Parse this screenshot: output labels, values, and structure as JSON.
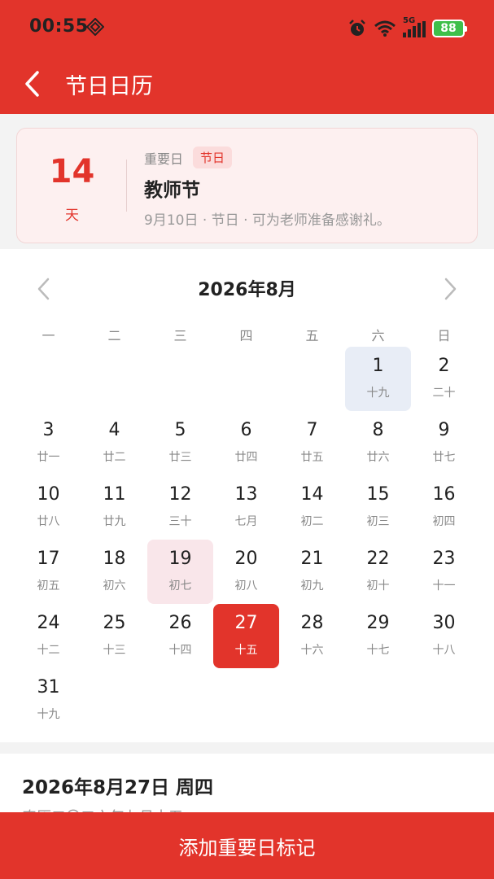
{
  "status_bar": {
    "time": "00:55",
    "network": "5G",
    "battery": "88"
  },
  "nav": {
    "title": "节日日历"
  },
  "event_card": {
    "count": "14",
    "count_unit": "天",
    "category": "重要日",
    "tag": "节日",
    "title": "教师节",
    "description": "9月10日 · 节日 · 可为老师准备感谢礼。"
  },
  "calendar": {
    "month_label": "2026年8月",
    "weekdays": [
      "一",
      "二",
      "三",
      "四",
      "五",
      "六",
      "日"
    ],
    "days": [
      {
        "num": "1",
        "lunar": "十九"
      },
      {
        "num": "2",
        "lunar": "二十"
      },
      {
        "num": "3",
        "lunar": "廿一"
      },
      {
        "num": "4",
        "lunar": "廿二"
      },
      {
        "num": "5",
        "lunar": "廿三"
      },
      {
        "num": "6",
        "lunar": "廿四"
      },
      {
        "num": "7",
        "lunar": "廿五"
      },
      {
        "num": "8",
        "lunar": "廿六"
      },
      {
        "num": "9",
        "lunar": "廿七"
      },
      {
        "num": "10",
        "lunar": "廿八"
      },
      {
        "num": "11",
        "lunar": "廿九"
      },
      {
        "num": "12",
        "lunar": "三十"
      },
      {
        "num": "13",
        "lunar": "七月"
      },
      {
        "num": "14",
        "lunar": "初二"
      },
      {
        "num": "15",
        "lunar": "初三"
      },
      {
        "num": "16",
        "lunar": "初四"
      },
      {
        "num": "17",
        "lunar": "初五"
      },
      {
        "num": "18",
        "lunar": "初六"
      },
      {
        "num": "19",
        "lunar": "初七"
      },
      {
        "num": "20",
        "lunar": "初八"
      },
      {
        "num": "21",
        "lunar": "初九"
      },
      {
        "num": "22",
        "lunar": "初十"
      },
      {
        "num": "23",
        "lunar": "十一"
      },
      {
        "num": "24",
        "lunar": "十二"
      },
      {
        "num": "25",
        "lunar": "十三"
      },
      {
        "num": "26",
        "lunar": "十四"
      },
      {
        "num": "27",
        "lunar": "十五"
      },
      {
        "num": "28",
        "lunar": "十六"
      },
      {
        "num": "29",
        "lunar": "十七"
      },
      {
        "num": "30",
        "lunar": "十八"
      },
      {
        "num": "31",
        "lunar": "十九"
      }
    ]
  },
  "detail": {
    "date": "2026年8月27日 周四",
    "lunar": "农历二〇二六年七月十五"
  },
  "action_button": {
    "label": "添加重要日标记"
  },
  "colors": {
    "accent": "#e2342b",
    "today_bg": "#e8edf6",
    "marked_bg": "#f9e6ea",
    "card_bg": "#fdf0f0"
  },
  "icons": {
    "back": "chevron-left-icon",
    "prev_month": "chevron-left-icon",
    "next_month": "chevron-right-icon"
  }
}
